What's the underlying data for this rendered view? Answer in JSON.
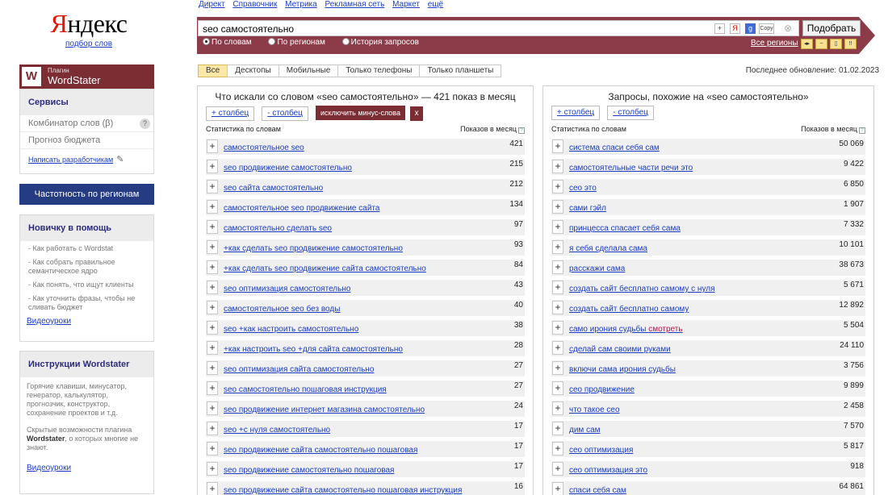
{
  "logo": {
    "brand_first": "Я",
    "brand_rest": "ндекс",
    "subtitle": "подбор слов"
  },
  "plugin": {
    "w": "W",
    "label_small": "Плагин",
    "label_big": "WordStater"
  },
  "services": {
    "header": "Сервисы",
    "items": [
      "Комбинатор слов (β)",
      "Прогноз бюджета"
    ],
    "help_q": "?",
    "write_dev": "Написать разработчикам"
  },
  "region_button": "Частотность по регионам",
  "newbie": {
    "header": "Новичку в помощь",
    "items": [
      "- Как работать с Wordstat",
      "- Как собрать правильное семантическое ядро",
      "- Как понять, что ищут клиенты",
      "- Как уточнить фразы, чтобы не сливать бюджет"
    ],
    "video": "Видеоуроки"
  },
  "instructions": {
    "header": "Инструкции Wordstater",
    "text1": "Горячие клавиши, минусатор, генератор, калькулятор, прогнозчик, конструктор, сохранение проектов и т.д.",
    "text2_pre": "Скрытые возможности плагина ",
    "text2_bold": "Wordstater",
    "text2_post": ", о которых многие не знают.",
    "video": "Видеоуроки"
  },
  "topnav": [
    "Директ",
    "Справочник",
    "Метрика",
    "Рекламная сеть",
    "Маркет",
    "ещё"
  ],
  "search": {
    "query": "seo самостоятельно",
    "icons": {
      "plus": "+",
      "ya": "Я",
      "g": "g",
      "copy": "Copy",
      "clear": "⊗"
    },
    "button": "Подобрать",
    "radios": [
      "По словам",
      "По регионам",
      "История запросов"
    ],
    "selected_radio": 0,
    "all_regions": "Все регионы",
    "mini_buttons": [
      "◂▸",
      "−",
      "▯",
      "!!"
    ]
  },
  "filter_tabs": [
    "Все",
    "Десктопы",
    "Мобильные",
    "Только телефоны",
    "Только планшеты"
  ],
  "active_tab": 0,
  "last_update": "Последнее обновление: 01.02.2023",
  "left_panel": {
    "title": "Что искали со словом «seo самостоятельно» — 421 показ в месяц",
    "add_col": "+ столбец",
    "remove_col": "- столбец",
    "exclude": "исключить минус-слова",
    "exclude_x": "x",
    "col_phrase": "Статистика по словам",
    "col_count": "Показов в месяц",
    "rows": [
      [
        "самостоятельное seo",
        "421"
      ],
      [
        "seo продвижение самостоятельно",
        "215"
      ],
      [
        "seo сайта самостоятельно",
        "212"
      ],
      [
        "самостоятельное seo продвижение сайта",
        "134"
      ],
      [
        "самостоятельно сделать seo",
        "97"
      ],
      [
        "+как сделать seo продвижение самостоятельно",
        "93"
      ],
      [
        "+как сделать seo продвижение сайта самостоятельно",
        "84"
      ],
      [
        "seo оптимизация самостоятельно",
        "43"
      ],
      [
        "самостоятельное seo без воды",
        "40"
      ],
      [
        "seo +как настроить самостоятельно",
        "38"
      ],
      [
        "+как настроить seo +для сайта самостоятельно",
        "28"
      ],
      [
        "seo оптимизация сайта самостоятельно",
        "27"
      ],
      [
        "seo самостоятельно пошаговая инструкция",
        "27"
      ],
      [
        "seo продвижение интернет магазина самостоятельно",
        "24"
      ],
      [
        "seo +с нуля самостоятельно",
        "17"
      ],
      [
        "seo продвижение сайта самостоятельно пошаговая",
        "17"
      ],
      [
        "seo продвижение самостоятельно пошаговая",
        "17"
      ],
      [
        "seo продвижение сайта самостоятельно пошаговая инструкция",
        "16"
      ]
    ]
  },
  "right_panel": {
    "title": "Запросы, похожие на «seo самостоятельно»",
    "add_col": "+ столбец",
    "remove_col": "- столбец",
    "col_phrase": "Статистика по словам",
    "col_count": "Показов в месяц",
    "rows": [
      [
        "система спаси себя сам",
        "50 069"
      ],
      [
        "самостоятельные части речи это",
        "9 422"
      ],
      [
        "сео это",
        "6 850"
      ],
      [
        "сами гэйл",
        "1 907"
      ],
      [
        "принцесса спасает себя сама",
        "7 332"
      ],
      [
        "я себя сделала сама",
        "10 101"
      ],
      [
        "расскажи сама",
        "38 673"
      ],
      [
        "создать сайт бесплатно самому с нуля",
        "5 671"
      ],
      [
        "создать сайт бесплатно самому",
        "12 892"
      ],
      [
        "само ирония судьбы смотреть",
        "5 504"
      ],
      [
        "сделай сам своими руками",
        "24 110"
      ],
      [
        "включи сама ирония судьбы",
        "3 756"
      ],
      [
        "сео продвижение",
        "9 899"
      ],
      [
        "что такое сео",
        "2 458"
      ],
      [
        "дим сам",
        "7 570"
      ],
      [
        "сео оптимизация",
        "5 817"
      ],
      [
        "сео оптимизация это",
        "918"
      ],
      [
        "спаси себя сам",
        "64 861"
      ]
    ],
    "highlight_row": 9,
    "highlight_word": "смотреть"
  },
  "colors": {
    "brand_red": "#e61400",
    "plugin": "#7b2d33",
    "searchbar": "#8c3b49",
    "nav_blue": "#253b82",
    "link": "#1a3dc1",
    "tab_active": "#fbe7a6"
  }
}
